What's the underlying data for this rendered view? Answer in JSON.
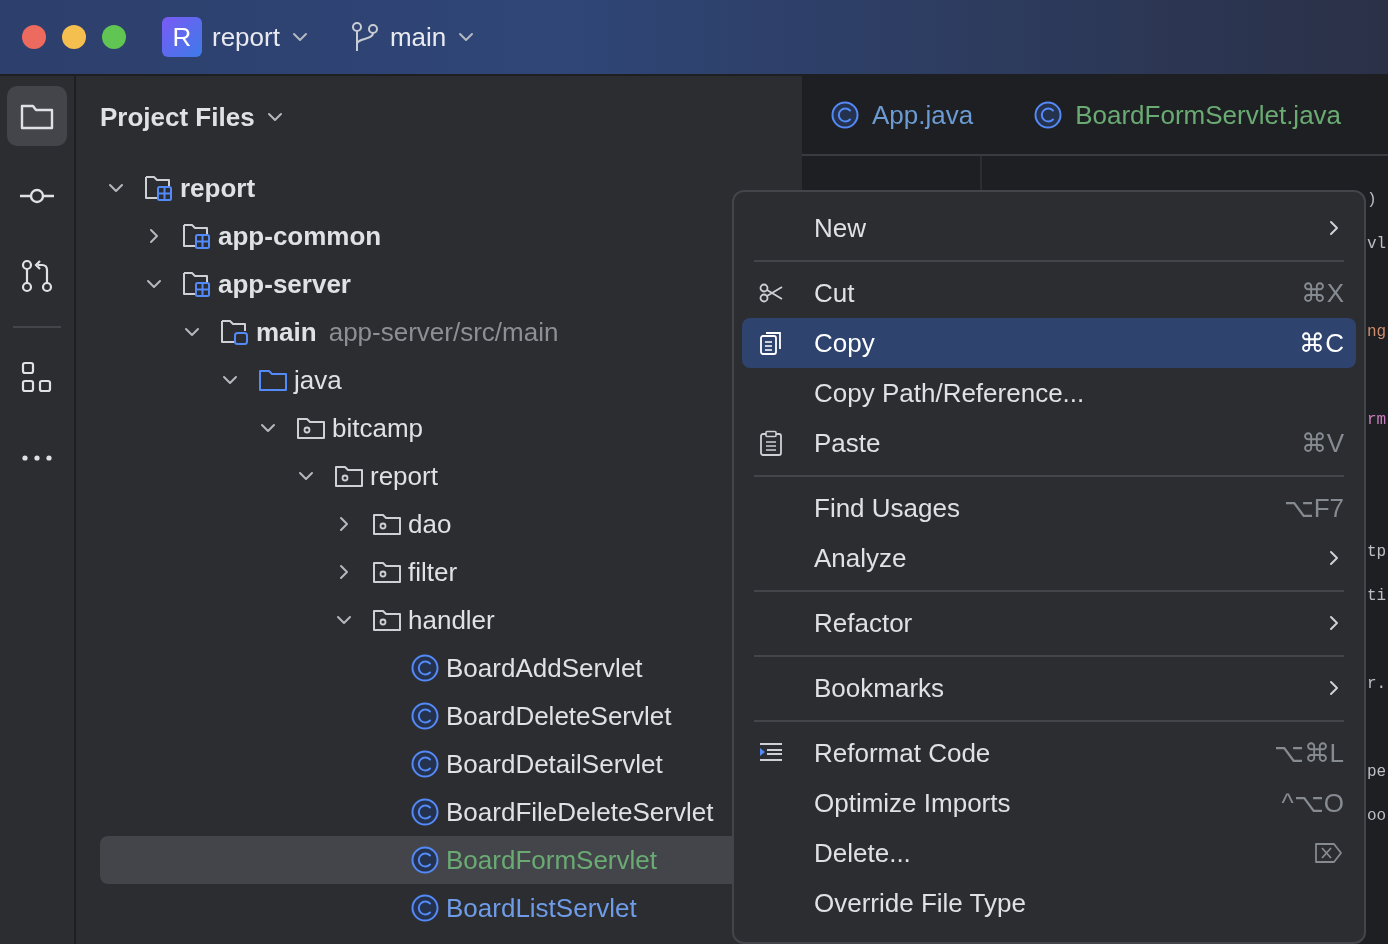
{
  "title_bar": {
    "project": {
      "badge": "R",
      "label": "report"
    },
    "branch": {
      "label": "main"
    }
  },
  "tool_strip": [
    {
      "kind": "project",
      "selected": true
    },
    {
      "kind": "commit",
      "selected": false
    },
    {
      "kind": "pull_requests",
      "selected": false
    },
    {
      "kind": "structure",
      "selected": false
    },
    {
      "kind": "more",
      "selected": false
    }
  ],
  "project_panel": {
    "title": "Project Files",
    "tree": [
      {
        "label": "report",
        "kind": "module",
        "expanded": true,
        "selected": false,
        "children": [
          {
            "label": "app-common",
            "kind": "module",
            "expanded": false,
            "selected": false
          },
          {
            "label": "app-server",
            "kind": "module",
            "expanded": true,
            "selected": false,
            "children": [
              {
                "label": "main",
                "path": "app-server/src/main",
                "kind": "source_set",
                "expanded": true,
                "selected": false,
                "children": [
                  {
                    "label": "java",
                    "kind": "source_root",
                    "expanded": true,
                    "selected": false,
                    "children": [
                      {
                        "label": "bitcamp",
                        "kind": "package",
                        "expanded": true,
                        "selected": false,
                        "children": [
                          {
                            "label": "report",
                            "kind": "package",
                            "expanded": true,
                            "selected": false,
                            "children": [
                              {
                                "label": "dao",
                                "kind": "package",
                                "expanded": false,
                                "selected": false
                              },
                              {
                                "label": "filter",
                                "kind": "package",
                                "expanded": false,
                                "selected": false
                              },
                              {
                                "label": "handler",
                                "kind": "package",
                                "expanded": true,
                                "selected": false,
                                "children": [
                                  {
                                    "label": "BoardAddServlet",
                                    "kind": "class",
                                    "color": "#dfe1e5",
                                    "selected": false
                                  },
                                  {
                                    "label": "BoardDeleteServlet",
                                    "kind": "class",
                                    "color": "#dfe1e5",
                                    "selected": false
                                  },
                                  {
                                    "label": "BoardDetailServlet",
                                    "kind": "class",
                                    "color": "#dfe1e5",
                                    "selected": false
                                  },
                                  {
                                    "label": "BoardFileDeleteServlet",
                                    "kind": "class",
                                    "color": "#dfe1e5",
                                    "selected": false
                                  },
                                  {
                                    "label": "BoardFormServlet",
                                    "kind": "class",
                                    "color": "#6aab73",
                                    "selected": true
                                  },
                                  {
                                    "label": "BoardListServlet",
                                    "kind": "class",
                                    "color": "#6f9ce8",
                                    "selected": false
                                  }
                                ]
                              }
                            ]
                          }
                        ]
                      }
                    ]
                  }
                ]
              }
            ]
          }
        ]
      }
    ]
  },
  "editor": {
    "tabs": [
      {
        "label": "App.java",
        "color": "#6b9bd2"
      },
      {
        "label": "BoardFormServlet.java",
        "color": "#6aab73"
      }
    ],
    "code_blocks": [
      [
        {
          "text": ")",
          "color": "#bcbec4"
        },
        {
          "text": "vl",
          "color": "#bcbec4"
        }
      ],
      [
        {
          "text": "ng",
          "color": "#ce8e6d"
        }
      ],
      [
        {
          "text": "rm",
          "color": "#c77dbb"
        }
      ],
      [
        {
          "text": "tp",
          "color": "#bcbec4"
        },
        {
          "text": "ti",
          "color": "#bcbec4"
        }
      ],
      [
        {
          "text": "r.",
          "color": "#bcbec4"
        }
      ],
      [
        {
          "text": "pe",
          "color": "#bcbec4"
        },
        {
          "text": "oo",
          "color": "#bcbec4"
        }
      ]
    ]
  },
  "context_menu": {
    "groups": [
      [
        {
          "label": "New",
          "submenu": true,
          "selected": false
        }
      ],
      [
        {
          "label": "Cut",
          "shortcut": "⌘X",
          "selected": false
        },
        {
          "label": "Copy",
          "shortcut": "⌘C",
          "selected": true
        },
        {
          "label": "Copy Path/Reference...",
          "selected": false
        },
        {
          "label": "Paste",
          "shortcut": "⌘V",
          "selected": false
        }
      ],
      [
        {
          "label": "Find Usages",
          "shortcut": "⌥F7",
          "selected": false
        },
        {
          "label": "Analyze",
          "submenu": true,
          "selected": false
        }
      ],
      [
        {
          "label": "Refactor",
          "submenu": true,
          "selected": false
        }
      ],
      [
        {
          "label": "Bookmarks",
          "submenu": true,
          "selected": false
        }
      ],
      [
        {
          "label": "Reformat Code",
          "shortcut": "⌥⌘L",
          "selected": false
        },
        {
          "label": "Optimize Imports",
          "shortcut": "^⌥O",
          "selected": false
        },
        {
          "label": "Delete...",
          "selected": false
        },
        {
          "label": "Override File Type",
          "selected": false
        }
      ]
    ]
  }
}
